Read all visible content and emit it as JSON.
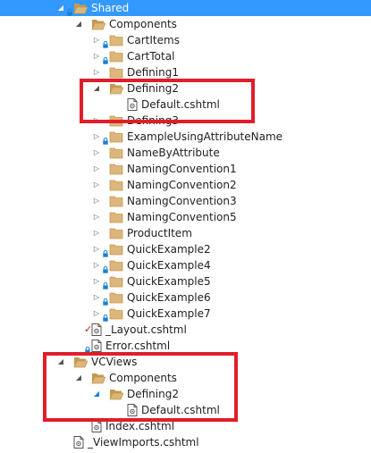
{
  "tree": [
    {
      "label": "Shared",
      "indent": 0,
      "exp": "open",
      "type": "folder-open",
      "lock": true,
      "selected": true
    },
    {
      "label": "Components",
      "indent": 1,
      "exp": "open",
      "type": "folder-open"
    },
    {
      "label": "CartItems",
      "indent": 2,
      "exp": "closed",
      "type": "folder",
      "lock": true
    },
    {
      "label": "CartTotal",
      "indent": 2,
      "exp": "closed",
      "type": "folder",
      "lock": true
    },
    {
      "label": "Defining1",
      "indent": 2,
      "exp": "closed",
      "type": "folder"
    },
    {
      "label": "Defining2",
      "indent": 2,
      "exp": "open",
      "type": "folder-open"
    },
    {
      "label": "Default.cshtml",
      "indent": 3,
      "exp": "none",
      "type": "file"
    },
    {
      "label": "Defining3",
      "indent": 2,
      "exp": "closed",
      "type": "folder"
    },
    {
      "label": "ExampleUsingAttributeName",
      "indent": 2,
      "exp": "closed",
      "type": "folder",
      "lock": true
    },
    {
      "label": "NameByAttribute",
      "indent": 2,
      "exp": "closed",
      "type": "folder"
    },
    {
      "label": "NamingConvention1",
      "indent": 2,
      "exp": "closed",
      "type": "folder"
    },
    {
      "label": "NamingConvention2",
      "indent": 2,
      "exp": "closed",
      "type": "folder"
    },
    {
      "label": "NamingConvention3",
      "indent": 2,
      "exp": "closed",
      "type": "folder"
    },
    {
      "label": "NamingConvention5",
      "indent": 2,
      "exp": "closed",
      "type": "folder"
    },
    {
      "label": "ProductItem",
      "indent": 2,
      "exp": "closed",
      "type": "folder"
    },
    {
      "label": "QuickExample2",
      "indent": 2,
      "exp": "closed",
      "type": "folder",
      "lock": true
    },
    {
      "label": "QuickExample4",
      "indent": 2,
      "exp": "closed",
      "type": "folder",
      "lock": true
    },
    {
      "label": "QuickExample5",
      "indent": 2,
      "exp": "closed",
      "type": "folder",
      "lock": true
    },
    {
      "label": "QuickExample6",
      "indent": 2,
      "exp": "closed",
      "type": "folder",
      "lock": true
    },
    {
      "label": "QuickExample7",
      "indent": 2,
      "exp": "closed",
      "type": "folder",
      "lock": true
    },
    {
      "label": "_Layout.cshtml",
      "indent": 1,
      "exp": "none",
      "type": "file",
      "check": true
    },
    {
      "label": "Error.cshtml",
      "indent": 1,
      "exp": "none",
      "type": "file",
      "lock": true
    },
    {
      "label": "VCViews",
      "indent": 0,
      "exp": "open",
      "type": "folder-open"
    },
    {
      "label": "Components",
      "indent": 1,
      "exp": "open",
      "type": "folder-open"
    },
    {
      "label": "Defining2",
      "indent": 2,
      "exp": "open-blue",
      "type": "folder-open"
    },
    {
      "label": "Default.cshtml",
      "indent": 3,
      "exp": "none",
      "type": "file"
    },
    {
      "label": "Index.cshtml",
      "indent": 1,
      "exp": "none",
      "type": "file"
    },
    {
      "label": "_ViewImports.cshtml",
      "indent": 0,
      "exp": "none",
      "type": "file"
    }
  ],
  "colors": {
    "folder": "#dcb67a",
    "folder_dark": "#c39a52",
    "highlight": "#e01e2a",
    "selection": "#3399ff",
    "lock": "#1a7fd4",
    "check": "#c42020"
  }
}
